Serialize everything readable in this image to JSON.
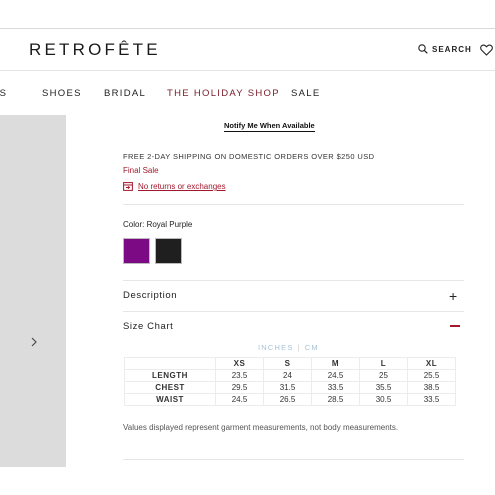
{
  "header": {
    "logo": "RETROFÊTE",
    "search_label": "SEARCH"
  },
  "nav": {
    "items": [
      "ES",
      "SHOES",
      "BRIDAL",
      "THE HOLIDAY SHOP",
      "SALE"
    ]
  },
  "product": {
    "notify_label": "Notify Me When Available",
    "shipping_text": "FREE 2-DAY SHIPPING ON DOMESTIC ORDERS OVER $250 USD",
    "final_sale": "Final Sale",
    "returns_text": "No returns or exchanges",
    "color_label": "Color:",
    "color_value": "Royal Purple",
    "swatches": [
      {
        "name": "Royal Purple",
        "color": "#7d0a85"
      },
      {
        "name": "Black",
        "color": "#1f1f1f"
      }
    ]
  },
  "accordion": {
    "description_title": "Description",
    "size_chart_title": "Size Chart"
  },
  "size_chart": {
    "units": [
      "INCHES",
      "CM"
    ],
    "unit_separator": "|",
    "active_unit": "INCHES",
    "columns": [
      "XS",
      "S",
      "M",
      "L",
      "XL"
    ],
    "rows": [
      {
        "label": "LENGTH",
        "values": [
          "23.5",
          "24",
          "24.5",
          "25",
          "25.5"
        ]
      },
      {
        "label": "CHEST",
        "values": [
          "29.5",
          "31.5",
          "33.5",
          "35.5",
          "38.5"
        ]
      },
      {
        "label": "WAIST",
        "values": [
          "24.5",
          "26.5",
          "28.5",
          "30.5",
          "33.5"
        ]
      }
    ],
    "note": "Values displayed represent garment measurements, not body measurements."
  },
  "colors": {
    "accent": "#a3182c",
    "holiday_nav": "#7a1c2a",
    "unit_toggle": "#a7c3d8"
  }
}
